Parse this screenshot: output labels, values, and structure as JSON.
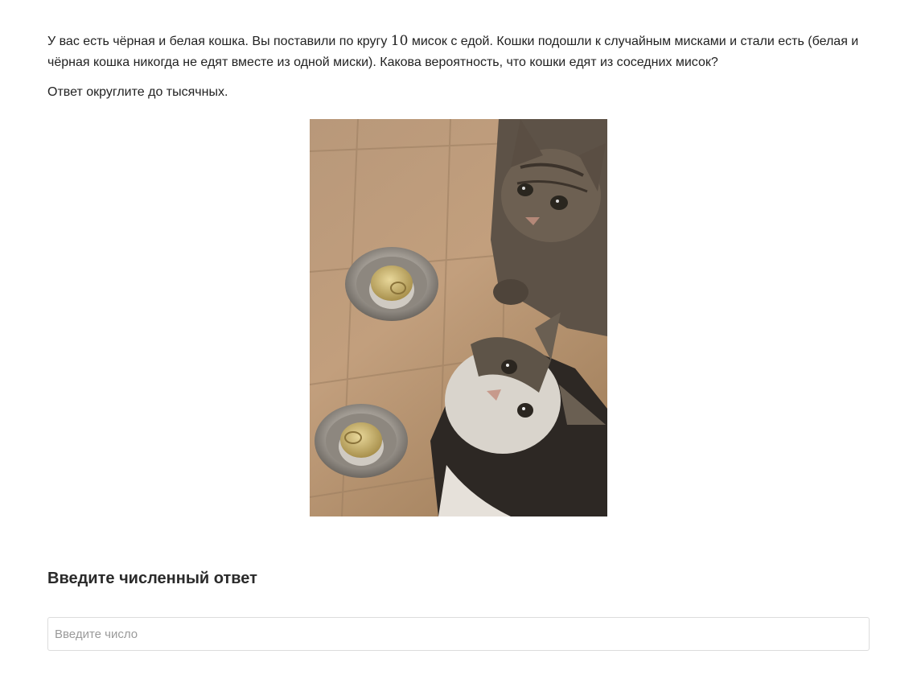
{
  "problem": {
    "text_before_number": "У вас есть чёрная и белая кошка. Вы поставили по кругу ",
    "number": "10",
    "text_after_number": " мисок с едой. Кошки подошли к случайным мисками и стали есть (белая и чёрная кошка никогда не едят вместе из одной миски). Какова вероятность, что кошки едят из соседних мисок?",
    "rounding_note": "Ответ округлите до тысячных."
  },
  "answer": {
    "heading": "Введите численный ответ",
    "placeholder": "Введите число",
    "value": ""
  },
  "colors": {
    "text": "#222222",
    "input_border": "#dcdcdc",
    "placeholder": "#9a9a9a"
  }
}
